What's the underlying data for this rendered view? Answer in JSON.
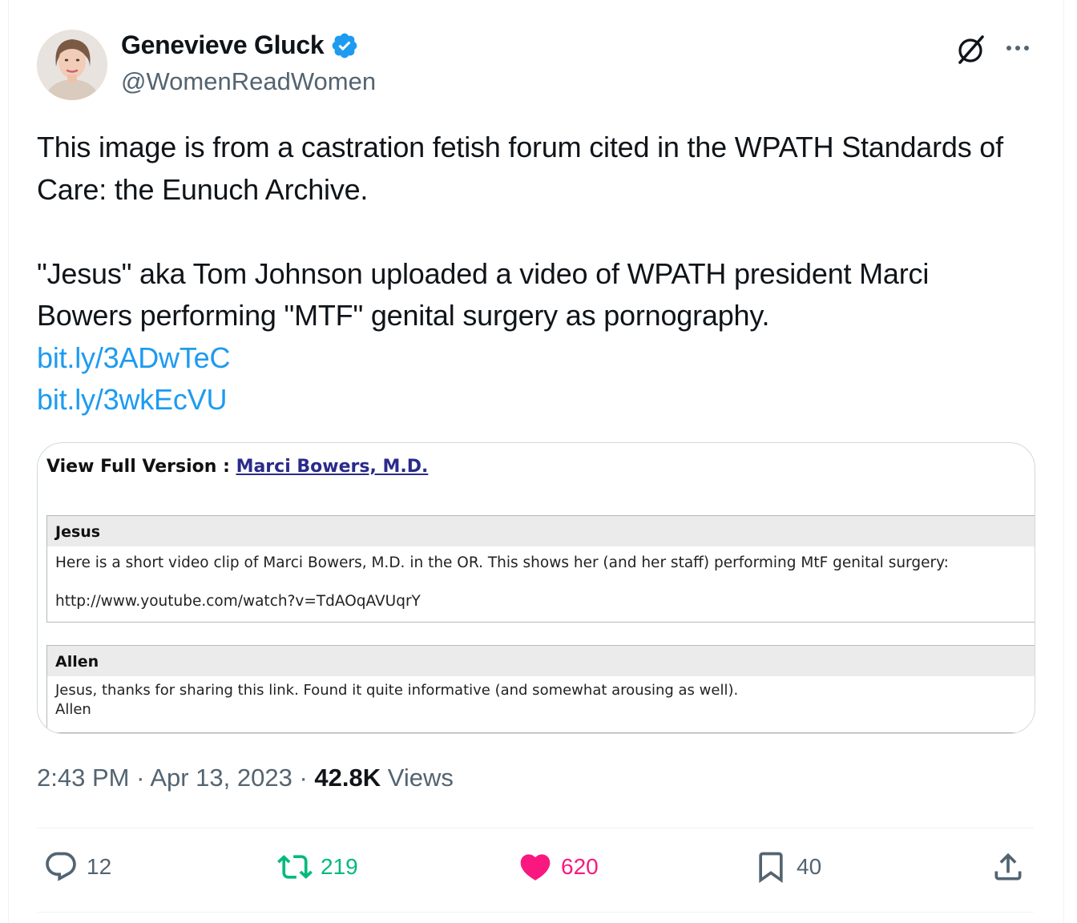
{
  "author": {
    "name": "Genevieve Gluck",
    "handle": "@WomenReadWomen",
    "verified": true,
    "verified_color": "#1d9bf0"
  },
  "header_icons": [
    "grok-icon",
    "more-icon"
  ],
  "tweet": {
    "paragraph1": "This image is from a castration fetish forum cited in the WPATH Standards of Care: the Eunuch Archive.",
    "paragraph2": "\"Jesus\" aka Tom Johnson uploaded a video of WPATH president Marci Bowers performing \"MTF\" genital surgery as pornography.",
    "links": [
      "bit.ly/3ADwTeC",
      "bit.ly/3wkEcVU"
    ],
    "link_color": "#1d9bf0"
  },
  "media": {
    "view_full_label": "View Full Version :",
    "view_full_link": "Marci Bowers, M.D.",
    "posts": [
      {
        "author": "Jesus",
        "lines": [
          "Here is a short video clip of Marci Bowers, M.D. in the OR. This shows her (and her staff) performing MtF genital surgery:",
          "http://www.youtube.com/watch?v=TdAOqAVUqrY"
        ]
      },
      {
        "author": "Allen",
        "lines": [
          "Jesus, thanks for sharing this link. Found it quite informative (and somewhat arousing as well).",
          "Allen"
        ]
      }
    ]
  },
  "meta": {
    "time": "2:43 PM",
    "sep1": "·",
    "date": "Apr 13, 2023",
    "sep2": "·",
    "views_count": "42.8K",
    "views_label": "Views"
  },
  "actions": {
    "reply": "12",
    "retweet": "219",
    "like": "620",
    "bookmark": "40",
    "retweet_color": "#00ba7c",
    "like_color": "#f91880"
  }
}
